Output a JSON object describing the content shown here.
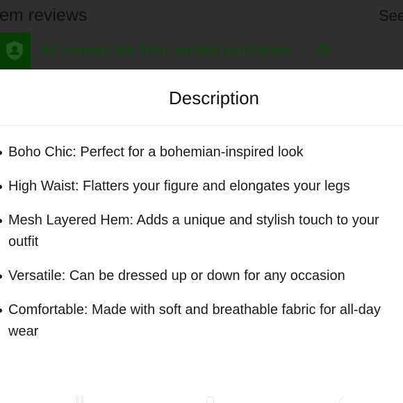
{
  "background": {
    "section_title": "tem reviews",
    "see_label": "See",
    "verified_text": "All reviews are from verified purchases",
    "help_glyph": "?",
    "shield_icon": "shield-person-icon",
    "verified_bg_color": "#053d03"
  },
  "sheet": {
    "title": "Description",
    "items": [
      {
        "text": "Boho Chic: Perfect for a bohemian-inspired look"
      },
      {
        "text": "High Waist: Flatters your figure and elongates your legs"
      },
      {
        "text": "Mesh Layered Hem: Adds a unique and stylish touch to your outfit"
      },
      {
        "text": "Versatile: Can be dressed up or down for any occasion"
      },
      {
        "text": "Comfortable: Made with soft and breathable fabric for all-day wear"
      }
    ]
  },
  "bottom_nav": {
    "icons": [
      "menu-icon",
      "home-icon",
      "back-icon"
    ]
  }
}
